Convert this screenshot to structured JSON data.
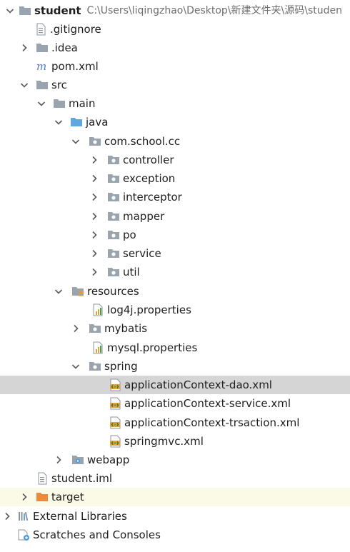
{
  "tree": {
    "root": {
      "label": "student",
      "path": "C:\\Users\\liqingzhao\\Desktop\\新建文件夹\\源码\\studen"
    },
    "gitignore": ".gitignore",
    "idea": ".idea",
    "pom": "pom.xml",
    "src": "src",
    "main": "main",
    "java": "java",
    "pkg": "com.school.cc",
    "controller": "controller",
    "exception": "exception",
    "interceptor": "interceptor",
    "mapper": "mapper",
    "po": "po",
    "service": "service",
    "util": "util",
    "resources": "resources",
    "log4j": "log4j.properties",
    "mybatis": "mybatis",
    "mysql": "mysql.properties",
    "spring": "spring",
    "ctx_dao": "applicationContext-dao.xml",
    "ctx_service": "applicationContext-service.xml",
    "ctx_trsaction": "applicationContext-trsaction.xml",
    "springmvc": "springmvc.xml",
    "webapp": "webapp",
    "iml": "student.iml",
    "target": "target",
    "external": "External Libraries",
    "scratches": "Scratches and Consoles"
  },
  "icons": {
    "folder": "#909aa5",
    "java_folder": "#5aa0dc",
    "excluded_folder": "#e8803a",
    "properties_bar": "#e2a23a"
  }
}
